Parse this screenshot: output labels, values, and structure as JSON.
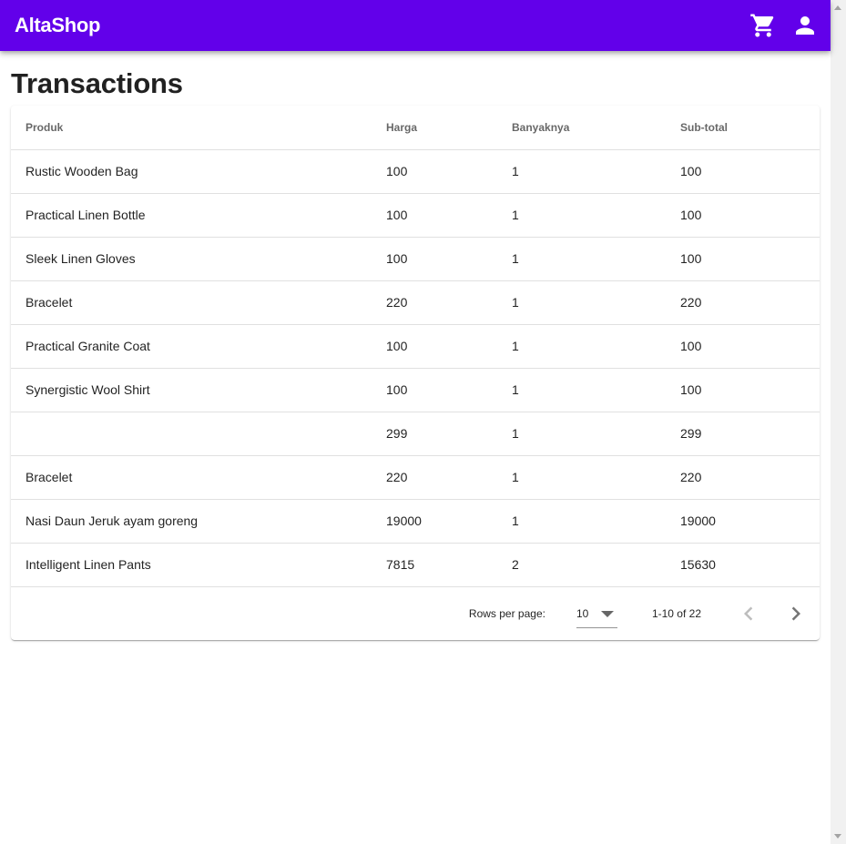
{
  "app": {
    "brand": "AltaShop"
  },
  "header": {
    "icons": [
      "cart-icon",
      "account-icon"
    ]
  },
  "page": {
    "title": "Transactions"
  },
  "table": {
    "columns": [
      "Produk",
      "Harga",
      "Banyaknya",
      "Sub-total"
    ],
    "rows": [
      [
        "Rustic Wooden Bag",
        "100",
        "1",
        "100"
      ],
      [
        "Practical Linen Bottle",
        "100",
        "1",
        "100"
      ],
      [
        "Sleek Linen Gloves",
        "100",
        "1",
        "100"
      ],
      [
        "Bracelet",
        "220",
        "1",
        "220"
      ],
      [
        "Practical Granite Coat",
        "100",
        "1",
        "100"
      ],
      [
        "Synergistic Wool Shirt",
        "100",
        "1",
        "100"
      ],
      [
        "",
        "299",
        "1",
        "299"
      ],
      [
        "Bracelet",
        "220",
        "1",
        "220"
      ],
      [
        "Nasi Daun Jeruk ayam goreng",
        "19000",
        "1",
        "19000"
      ],
      [
        "Intelligent Linen Pants",
        "7815",
        "2",
        "15630"
      ]
    ]
  },
  "pagination": {
    "rows_per_page_label": "Rows per page:",
    "rows_per_page_value": "10",
    "range_text": "1-10 of 22"
  },
  "colors": {
    "app_bar": "#6200ea"
  }
}
